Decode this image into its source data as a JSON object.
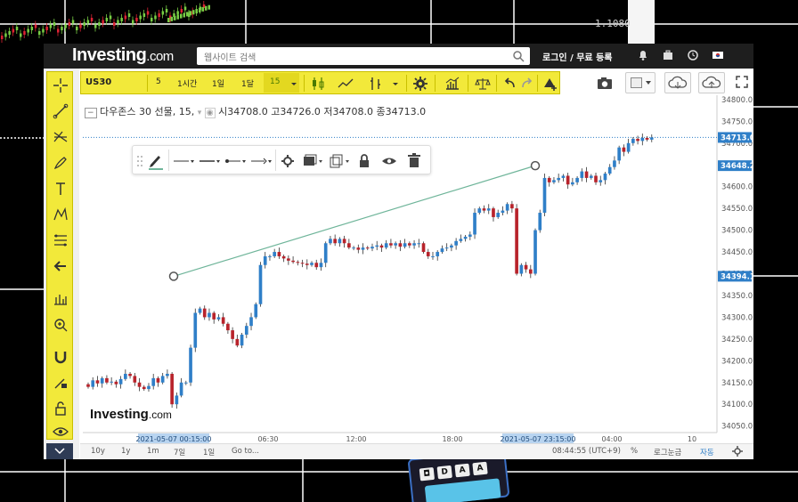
{
  "background": {
    "monitor_price": "1.1080"
  },
  "header": {
    "logo_main": "Investing",
    "logo_suffix": ".com",
    "search_placeholder": "웹사이트 검색",
    "login_text": "로그인 / 무료 등록"
  },
  "chart_toolbar": {
    "symbol": "US30",
    "intervals": [
      "5",
      "1시간",
      "1일",
      "1달",
      "15"
    ],
    "active_interval": "15"
  },
  "info_line": {
    "name": "다우존스 30 선물, 15,",
    "open_label": "시",
    "open": "34708.0",
    "high_label": "고",
    "high": "34726.0",
    "low_label": "저",
    "low": "34708.0",
    "close_label": "종",
    "close": "34713.0"
  },
  "watermark": {
    "main": "Investing",
    "suffix": ".com"
  },
  "bottom_bar": {
    "ranges": [
      "10y",
      "1y",
      "1m",
      "7일",
      "1일"
    ],
    "goto": "Go to...",
    "time": "08:44:55 (UTC+9)",
    "percent": "%",
    "log": "로그눈금",
    "auto": "자동"
  },
  "colors": {
    "up": "#2f7fc8",
    "down": "#b8232b",
    "trendline": "#6fb59a",
    "last_price_tag": "#2f7fc8",
    "toolbar_yellow": "#f2e93a"
  },
  "chart_data": {
    "type": "candlestick",
    "symbol": "US30",
    "y_ticks": [
      34800.0,
      34750.0,
      34700.0,
      34650.0,
      34600.0,
      34550.0,
      34500.0,
      34450.0,
      34400.0,
      34350.0,
      34300.0,
      34250.0,
      34200.0,
      34150.0,
      34100.0,
      34050.0
    ],
    "ylim": [
      34035,
      34810
    ],
    "x_ticks": [
      "2021-05-07 00:15:00",
      "06:30",
      "12:00",
      "18:00",
      "2021-05-07 23:15:00",
      "04:00",
      "10"
    ],
    "price_tags": [
      "34713.0",
      "34648.2",
      "34394.1"
    ],
    "trendline": {
      "start_price": 34394.1,
      "end_price": 34648.2
    },
    "closes": [
      34140,
      34155,
      34148,
      34160,
      34150,
      34152,
      34146,
      34158,
      34170,
      34165,
      34150,
      34140,
      34135,
      34142,
      34160,
      34150,
      34165,
      34170,
      34100,
      34120,
      34150,
      34150,
      34230,
      34310,
      34320,
      34300,
      34310,
      34295,
      34300,
      34285,
      34270,
      34250,
      34235,
      34260,
      34280,
      34300,
      34330,
      34420,
      34440,
      34440,
      34450,
      34440,
      34435,
      34430,
      34427,
      34425,
      34423,
      34420,
      34425,
      34415,
      34425,
      34470,
      34480,
      34470,
      34480,
      34470,
      34460,
      34460,
      34455,
      34460,
      34458,
      34462,
      34465,
      34460,
      34470,
      34465,
      34470,
      34462,
      34470,
      34465,
      34470,
      34470,
      34450,
      34440,
      34440,
      34450,
      34458,
      34460,
      34465,
      34475,
      34480,
      34485,
      34490,
      34540,
      34550,
      34545,
      34550,
      34530,
      34540,
      34545,
      34560,
      34550,
      34400,
      34420,
      34410,
      34400,
      34500,
      34540,
      34620,
      34610,
      34615,
      34620,
      34625,
      34605,
      34610,
      34620,
      34635,
      34620,
      34625,
      34610,
      34615,
      34630,
      34645,
      34660,
      34690,
      34680,
      34700,
      34710,
      34705,
      34712,
      34708,
      34713
    ]
  }
}
